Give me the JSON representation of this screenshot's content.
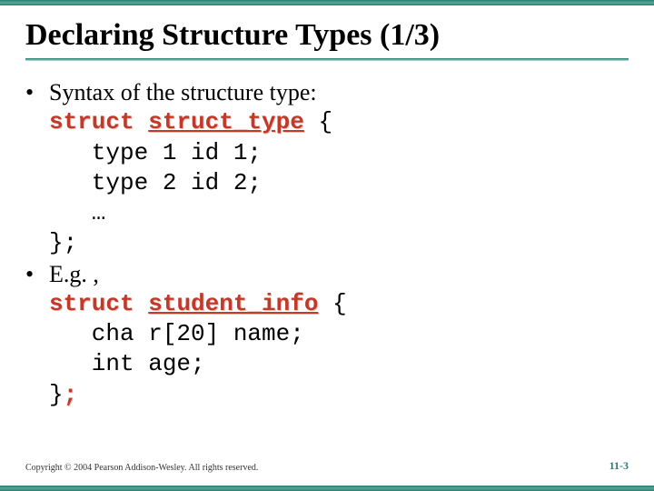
{
  "title": "Declaring Structure Types (1/3)",
  "bullets": {
    "b1": "Syntax of the structure type:",
    "b2": "E.g. ,"
  },
  "code1": {
    "kw": "struct",
    "tname": "struct_type",
    "open": " {",
    "l1": "   type 1 id 1;",
    "l2": "   type 2 id 2;",
    "l3": "   …",
    "close": "};"
  },
  "code2": {
    "kw": "struct",
    "tname": "student_info",
    "open": " {",
    "l1": "   cha r[20] name;",
    "l2": "   int age;",
    "closebrace": "}",
    "semi": ";"
  },
  "copyright": "Copyright © 2004 Pearson Addison-Wesley. All rights reserved.",
  "pagenum": "11-3"
}
